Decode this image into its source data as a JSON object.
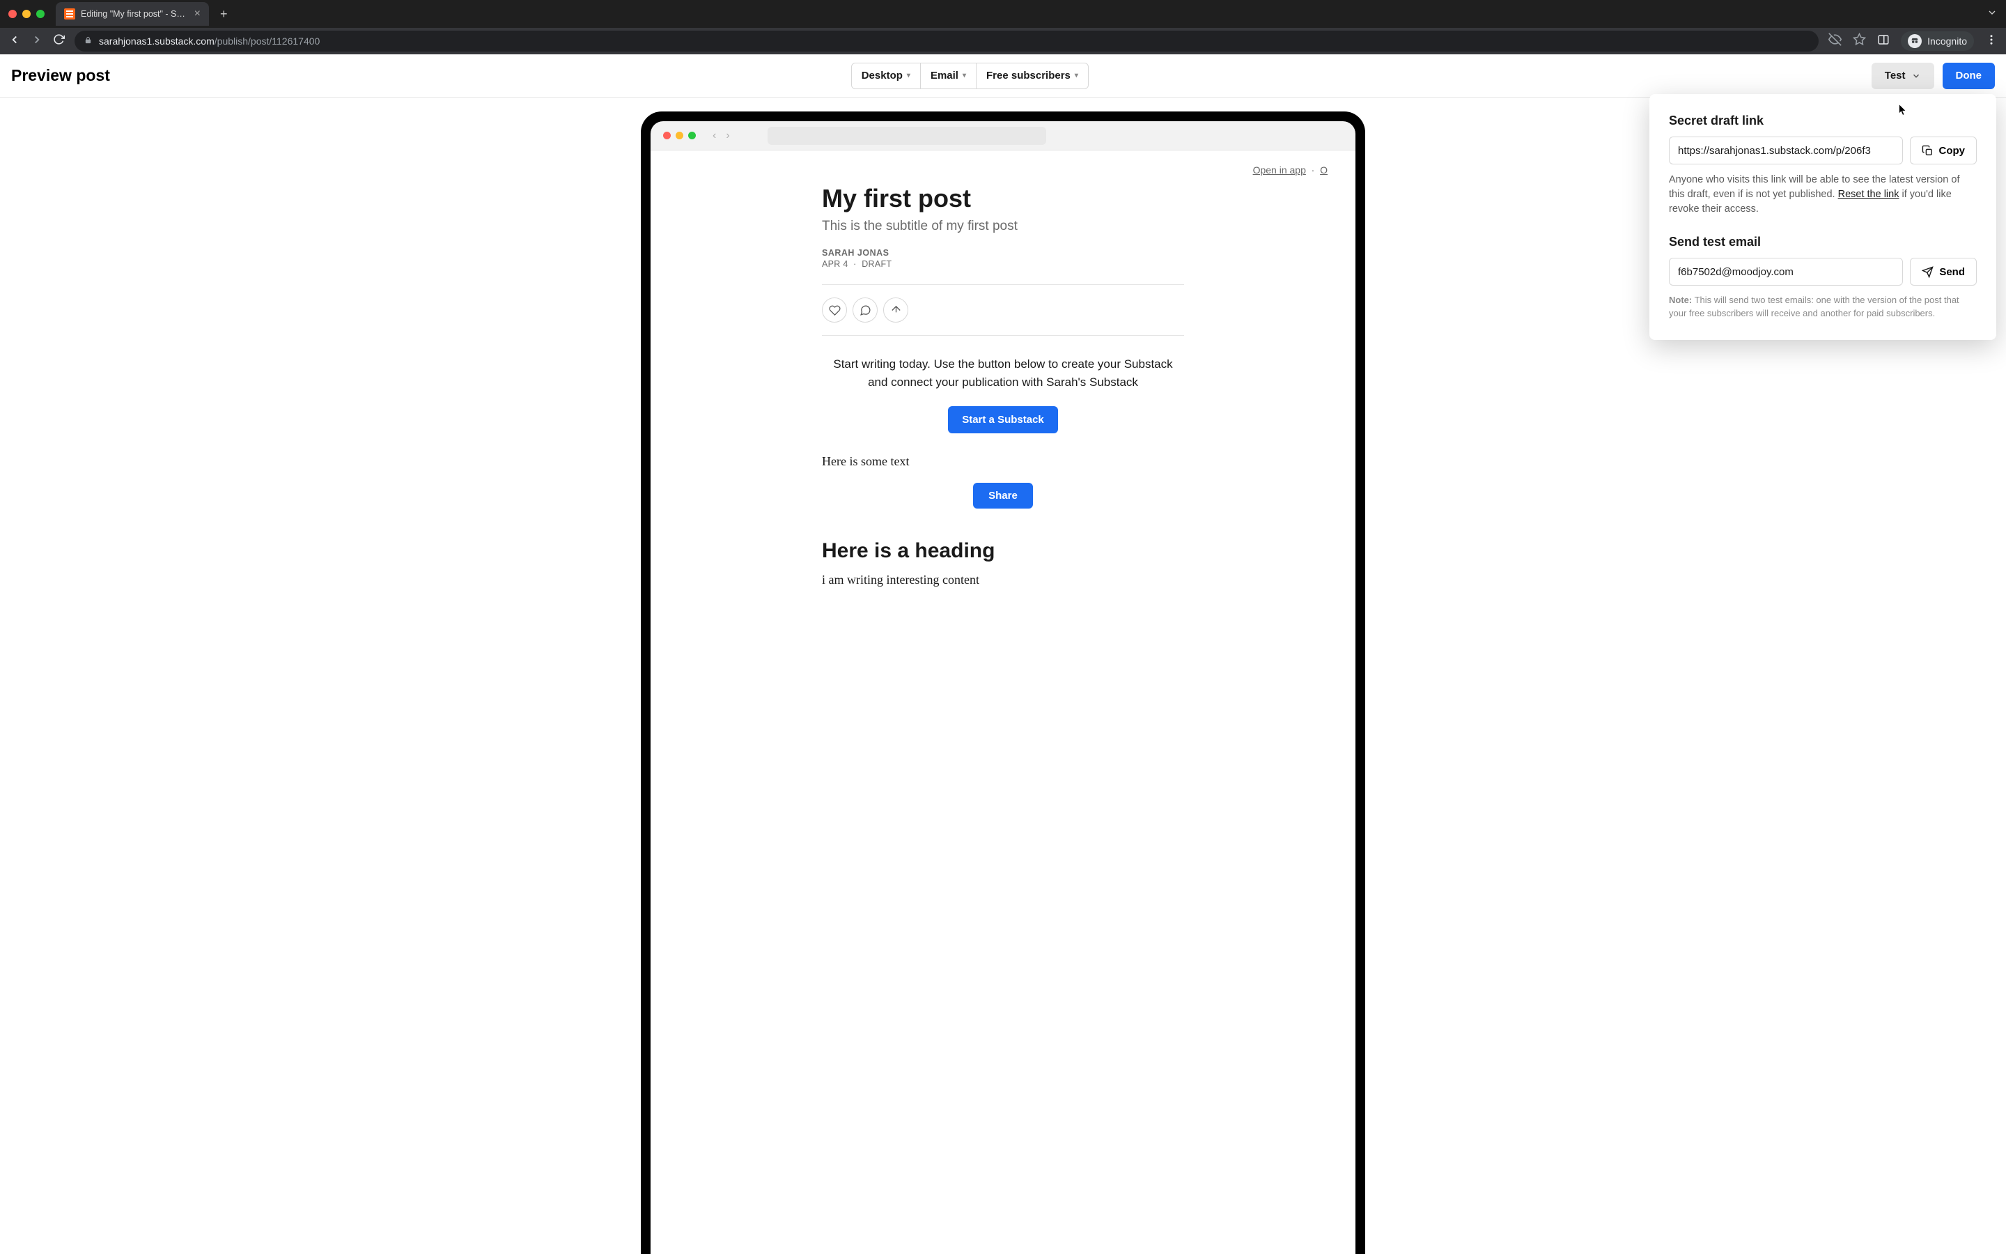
{
  "browser": {
    "tab_title": "Editing \"My first post\" - Subst…",
    "url_domain": "sarahjonas1.substack.com",
    "url_path": "/publish/post/112617400",
    "incognito_label": "Incognito"
  },
  "header": {
    "title": "Preview post",
    "segments": {
      "desktop": "Desktop",
      "email": "Email",
      "free": "Free subscribers"
    },
    "test_label": "Test",
    "done_label": "Done"
  },
  "device": {
    "top_links": {
      "open_app": "Open in app",
      "other": "O"
    }
  },
  "post": {
    "title": "My first post",
    "subtitle": "This is the subtitle of my first post",
    "author": "SARAH JONAS",
    "date": "APR 4",
    "status": "DRAFT",
    "promo": "Start writing today. Use the button below to create your Substack and connect your publication with Sarah's Substack",
    "cta_label": "Start a Substack",
    "body1": "Here is some text",
    "share_label": "Share",
    "heading": "Here is a heading",
    "body2": "i am writing interesting content"
  },
  "panel": {
    "secret_heading": "Secret draft link",
    "secret_url": "https://sarahjonas1.substack.com/p/206f3",
    "copy_label": "Copy",
    "secret_desc1": "Anyone who visits this link will be able to see the latest version of this draft, even if is not yet published. ",
    "reset_link": "Reset the link",
    "secret_desc2": " if you'd like revoke their access.",
    "test_heading": "Send test email",
    "test_email": "f6b7502d@moodjoy.com",
    "send_label": "Send",
    "note_label": "Note:",
    "note_text": " This will send two test emails: one with the version of the post that your free subscribers will receive and another for paid subscribers."
  }
}
